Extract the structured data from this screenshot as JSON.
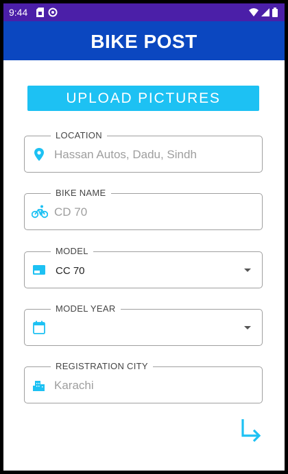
{
  "status_bar": {
    "time": "9:44"
  },
  "app_bar": {
    "title": "BIKE POST"
  },
  "upload_button": {
    "label": "UPLOAD PICTURES"
  },
  "fields": {
    "location": {
      "label": "LOCATION",
      "value": "Hassan Autos, Dadu, Sindh",
      "icon": "location-pin-icon"
    },
    "bike_name": {
      "label": "BIKE NAME",
      "value": "CD 70",
      "icon": "bicycle-icon"
    },
    "model": {
      "label": "MODEL",
      "value": "CC 70",
      "icon": "model-card-icon"
    },
    "model_year": {
      "label": "MODEL YEAR",
      "value": "",
      "icon": "calendar-icon"
    },
    "registration_city": {
      "label": "REGISTRATION CITY",
      "value": "Karachi",
      "icon": "city-icon"
    }
  },
  "colors": {
    "status_bar": "#4b1fa8",
    "app_bar": "#0b47c0",
    "accent": "#1dc1f3",
    "border": "#9e9e9e"
  }
}
